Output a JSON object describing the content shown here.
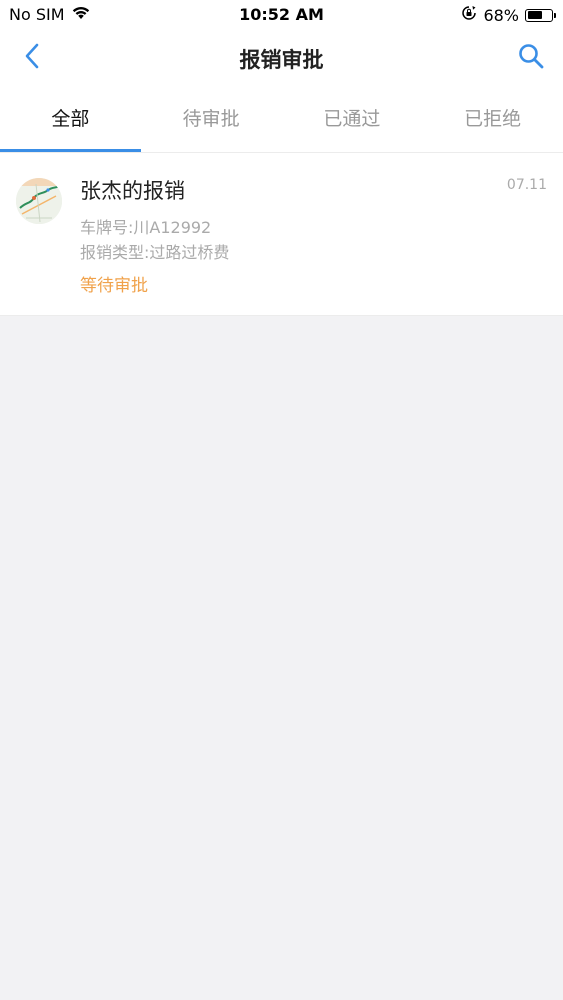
{
  "status_bar": {
    "carrier": "No SIM",
    "time": "10:52 AM",
    "battery_percent": "68%",
    "battery_level": 0.68,
    "wifi_icon": "wifi-icon",
    "orientation_lock_icon": "orientation-lock-icon"
  },
  "nav": {
    "title": "报销审批",
    "back_icon": "chevron-left-icon",
    "search_icon": "search-icon",
    "accent_color": "#3a8ee6"
  },
  "tabs": [
    {
      "label": "全部",
      "active": true
    },
    {
      "label": "待审批",
      "active": false
    },
    {
      "label": "已通过",
      "active": false
    },
    {
      "label": "已拒绝",
      "active": false
    }
  ],
  "list": [
    {
      "title": "张杰的报销",
      "date": "07.11",
      "plate": "车牌号:川A12992",
      "type": "报销类型:过路过桥费",
      "status": "等待审批",
      "status_color": "#f0a24b",
      "avatar_icon": "map-thumbnail-icon"
    }
  ]
}
